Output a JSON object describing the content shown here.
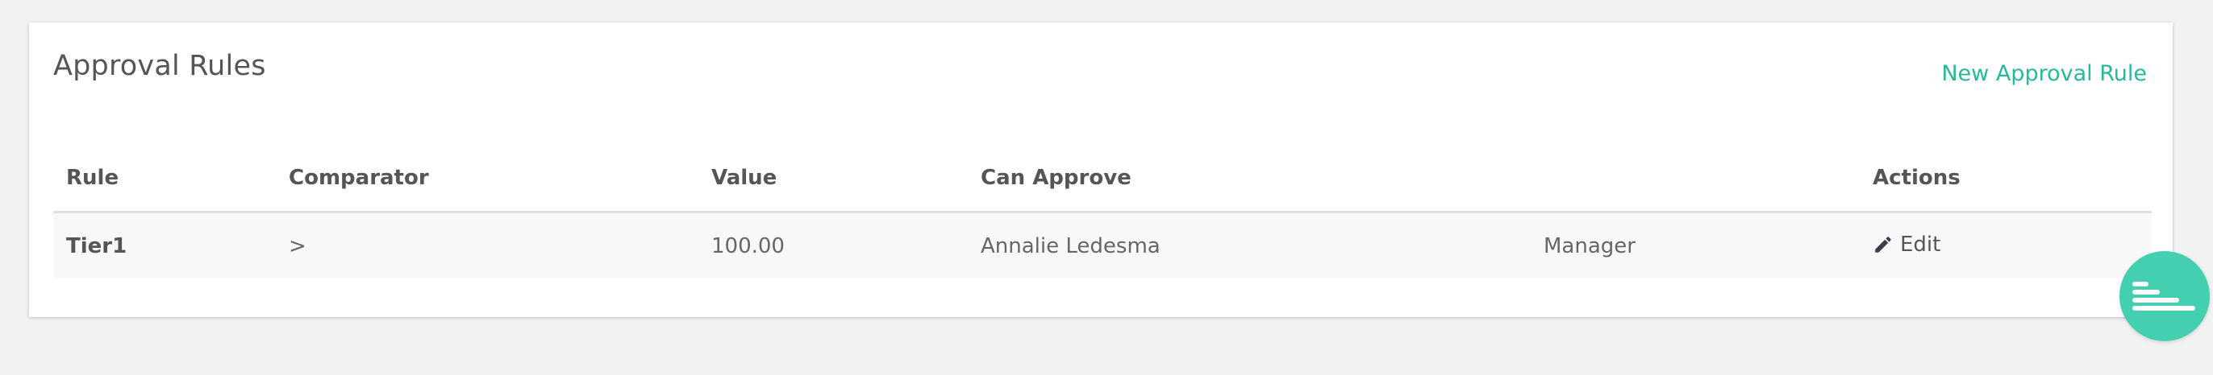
{
  "panel": {
    "title": "Approval Rules",
    "new_rule_label": "New Approval Rule"
  },
  "table": {
    "columns": [
      "Rule",
      "Comparator",
      "Value",
      "Can Approve",
      "",
      "Actions"
    ],
    "rows": [
      {
        "rule": "Tier1",
        "comparator": ">",
        "value": "100.00",
        "approver_name": "Annalie Ledesma",
        "approver_role": "Manager",
        "action_label": "Edit",
        "action_icon": "pencil-icon"
      }
    ]
  },
  "fab": {
    "icon": "bars-chart-icon"
  },
  "colors": {
    "accent": "#28b99a",
    "fab": "#44cfb0",
    "background": "#f2f2f2",
    "row_bg": "#f8f8f8"
  }
}
